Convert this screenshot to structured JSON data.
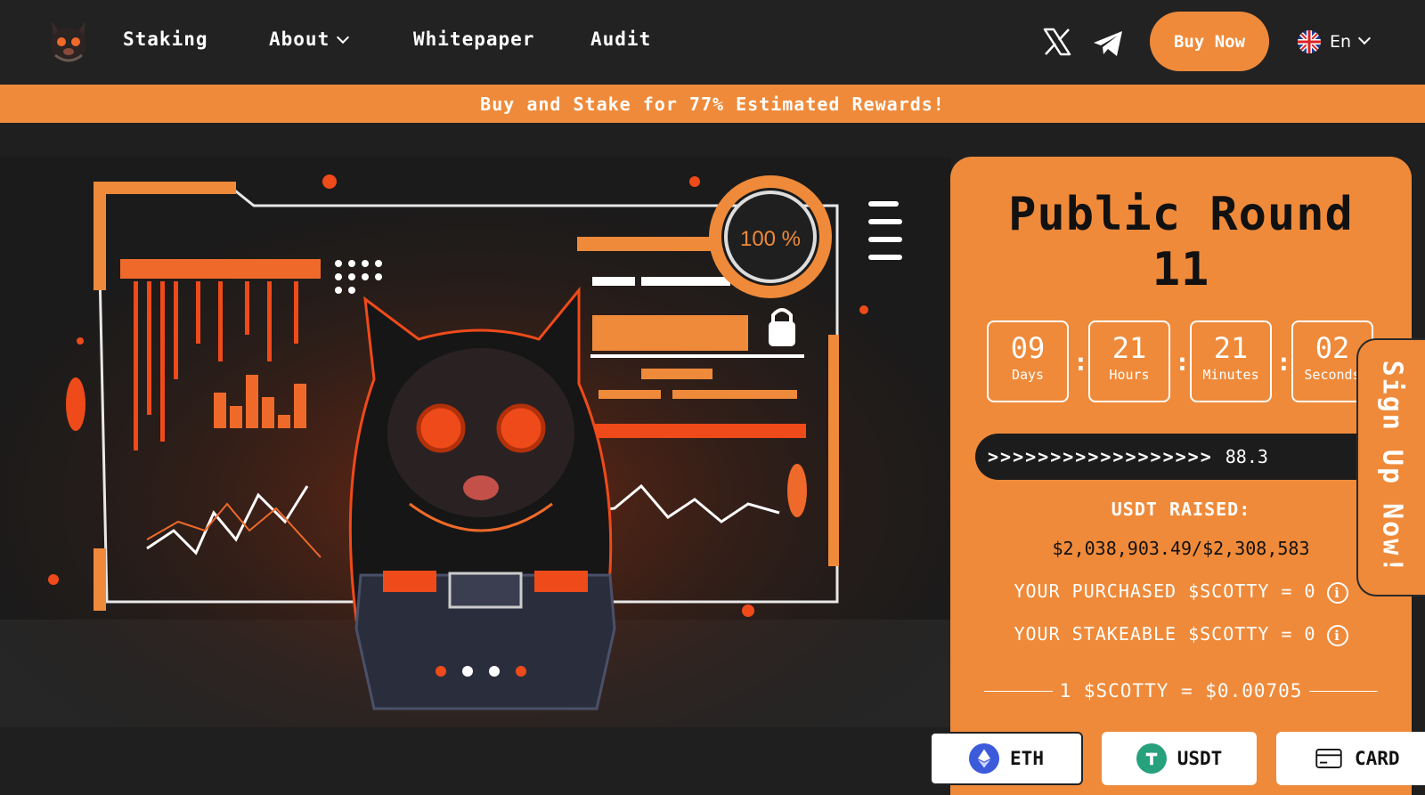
{
  "nav": {
    "links": [
      {
        "label": "Staking"
      },
      {
        "label": "About"
      },
      {
        "label": "Whitepaper"
      },
      {
        "label": "Audit"
      }
    ],
    "buy_now": "Buy Now",
    "language": "En"
  },
  "banner": {
    "text": "Buy and Stake for 77% Estimated Rewards!"
  },
  "hero": {
    "badge_text": "100 %"
  },
  "presale": {
    "title_line1": "Public Round",
    "title_line2": "11",
    "countdown": [
      {
        "value": "09",
        "label": "Days"
      },
      {
        "value": "21",
        "label": "Hours"
      },
      {
        "value": "21",
        "label": "Minutes"
      },
      {
        "value": "02",
        "label": "Seconds"
      }
    ],
    "progress_chevrons": ">>>>>>>>>>>>>>>>>>",
    "progress_text": "88.3",
    "raised_label": "USDT RAISED:",
    "raised_value": "$2,038,903.49/$2,308,583",
    "purchased_text": "YOUR PURCHASED $SCOTTY = 0",
    "stakeable_text": "YOUR STAKEABLE $SCOTTY = 0",
    "price_text": "1 $SCOTTY = $0.00705"
  },
  "pay_buttons": {
    "eth": "ETH",
    "usdt": "USDT",
    "card": "CARD"
  },
  "side_tab": {
    "text": "Sign Up Now!"
  },
  "colors": {
    "accent": "#ef8a3a",
    "nav_bg": "#222222",
    "page_bg": "#1f1f1f",
    "eth_blue": "#3b5bdb",
    "usdt_green": "#26a17b"
  }
}
